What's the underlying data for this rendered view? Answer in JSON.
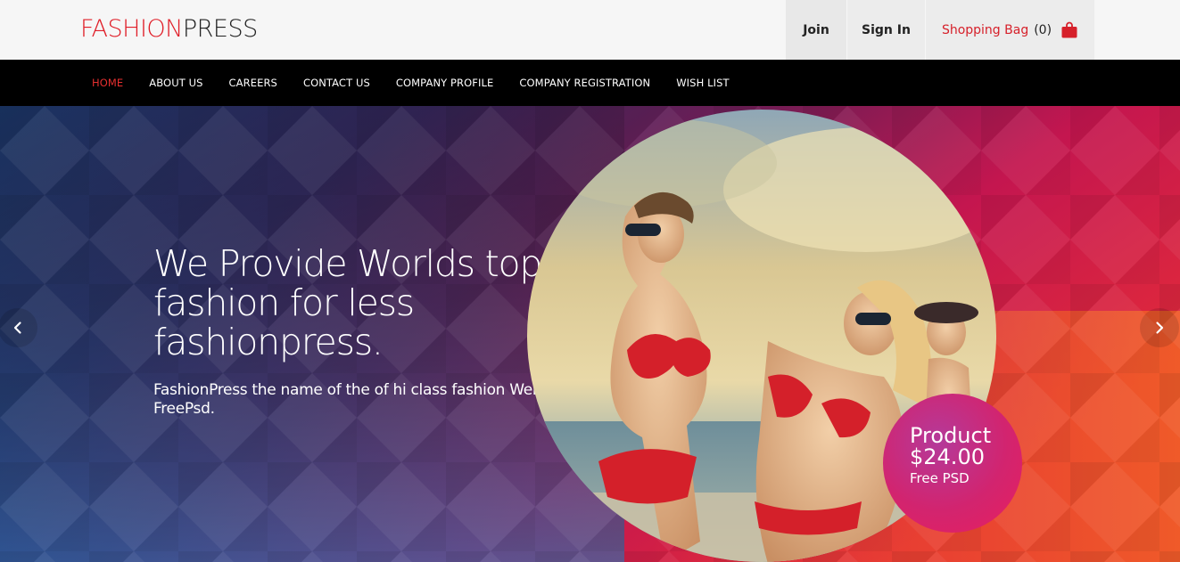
{
  "logo": {
    "part_a": "FASHION",
    "part_b": "PRESS"
  },
  "account": {
    "join_label": "Join",
    "signin_label": "Sign In",
    "bag_label": "Shopping Bag",
    "bag_count": "(0)",
    "bag_icon": "shopping-bag-icon"
  },
  "nav": {
    "items": [
      {
        "label": "HOME",
        "active": true
      },
      {
        "label": "ABOUT US",
        "active": false
      },
      {
        "label": "CAREERS",
        "active": false
      },
      {
        "label": "CONTACT US",
        "active": false
      },
      {
        "label": "COMPANY PROFILE",
        "active": false
      },
      {
        "label": "COMPANY REGISTRATION",
        "active": false
      },
      {
        "label": "WISH LIST",
        "active": false
      }
    ]
  },
  "hero": {
    "title_lines": [
      "We Provide Worlds top",
      "fashion for less",
      "fashionpress."
    ],
    "subtitle": "FashionPress the name of the of hi class fashion Web FreePsd.",
    "badge": {
      "product": "Product",
      "price": "$24.00",
      "note": "Free PSD"
    },
    "prev_icon": "chevron-left-icon",
    "next_icon": "chevron-right-icon"
  },
  "colors": {
    "brand_red": "#e01e28",
    "nav_bg": "#000000",
    "nav_active": "#e52f2f",
    "topbar_bg": "#f6f6f6",
    "badge_pink": "#d2246f"
  }
}
